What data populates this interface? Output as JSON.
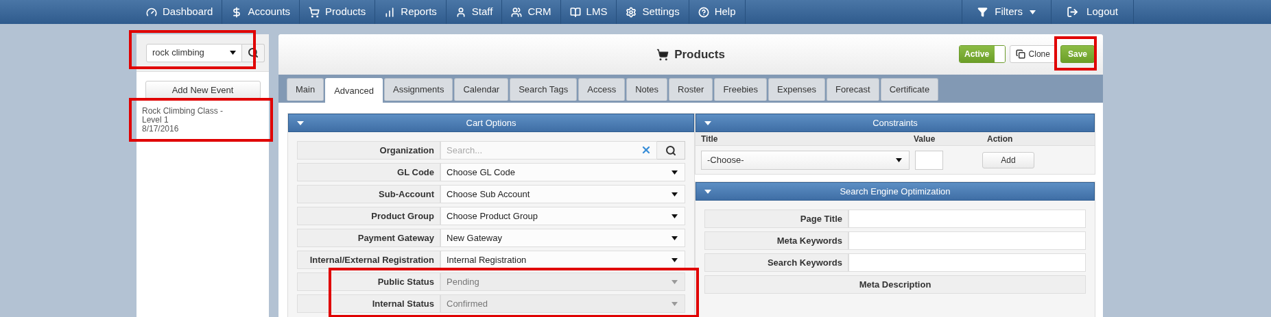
{
  "nav": {
    "items": [
      {
        "label": "Dashboard"
      },
      {
        "label": "Accounts"
      },
      {
        "label": "Products"
      },
      {
        "label": "Reports"
      },
      {
        "label": "Staff"
      },
      {
        "label": "CRM"
      },
      {
        "label": "LMS"
      },
      {
        "label": "Settings"
      },
      {
        "label": "Help"
      }
    ],
    "filters": "Filters",
    "logout": "Logout"
  },
  "sidebar": {
    "search": {
      "value": "rock climbing",
      "highlighted": true
    },
    "add_button": "Add New Event",
    "events": [
      {
        "title": "Rock Climbing Class - Level 1",
        "date": "8/17/2016",
        "highlighted": true
      }
    ]
  },
  "header": {
    "title": "Products",
    "active": {
      "label": "Active",
      "on": true
    },
    "clone": "Clone",
    "save": {
      "label": "Save",
      "highlighted": true
    }
  },
  "tabs": [
    {
      "label": "Main",
      "selected": false
    },
    {
      "label": "Advanced",
      "selected": true
    },
    {
      "label": "Assignments",
      "selected": false
    },
    {
      "label": "Calendar",
      "selected": false
    },
    {
      "label": "Search Tags",
      "selected": false
    },
    {
      "label": "Access",
      "selected": false
    },
    {
      "label": "Notes",
      "selected": false
    },
    {
      "label": "Roster",
      "selected": false
    },
    {
      "label": "Freebies",
      "selected": false
    },
    {
      "label": "Expenses",
      "selected": false
    },
    {
      "label": "Forecast",
      "selected": false
    },
    {
      "label": "Certificate",
      "selected": false
    }
  ],
  "cart_options": {
    "title": "Cart Options",
    "fields": [
      {
        "kind": "search",
        "label": "Organization",
        "placeholder": "Search...",
        "highlighted": false
      },
      {
        "kind": "select",
        "label": "GL Code",
        "value": "Choose GL Code",
        "disabled": false,
        "highlighted": false
      },
      {
        "kind": "select",
        "label": "Sub-Account",
        "value": "Choose Sub Account",
        "disabled": false,
        "highlighted": false
      },
      {
        "kind": "select",
        "label": "Product Group",
        "value": "Choose Product Group",
        "disabled": false,
        "highlighted": false
      },
      {
        "kind": "select",
        "label": "Payment Gateway",
        "value": "New Gateway",
        "disabled": false,
        "highlighted": false
      },
      {
        "kind": "select",
        "label": "Internal/External Registration",
        "value": "Internal Registration",
        "disabled": false,
        "highlighted": false
      },
      {
        "kind": "select",
        "label": "Public Status",
        "value": "Pending",
        "disabled": true,
        "highlighted": true
      },
      {
        "kind": "select",
        "label": "Internal Status",
        "value": "Confirmed",
        "disabled": true,
        "highlighted": true
      }
    ]
  },
  "constraints": {
    "title": "Constraints",
    "columns": [
      "Title",
      "Value",
      "Action"
    ],
    "select": "-Choose-",
    "button": "Add"
  },
  "seo": {
    "title": "Search Engine Optimization",
    "fields": [
      {
        "label": "Page Title"
      },
      {
        "label": "Meta Keywords"
      },
      {
        "label": "Search Keywords"
      }
    ],
    "description_label": "Meta Description"
  }
}
